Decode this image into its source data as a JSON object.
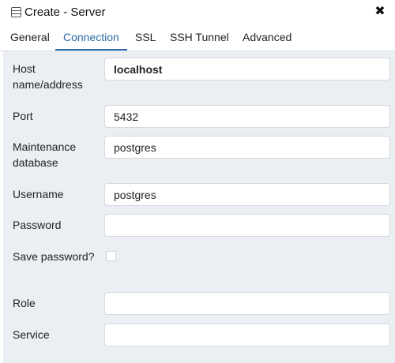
{
  "window": {
    "title": "Create - Server",
    "title_icon": "server-icon",
    "close_icon": "close-icon",
    "close_glyph": "✖"
  },
  "tabs": [
    {
      "label": "General"
    },
    {
      "label": "Connection",
      "active": true
    },
    {
      "label": "SSL"
    },
    {
      "label": "SSH Tunnel"
    },
    {
      "label": "Advanced"
    }
  ],
  "form": {
    "host": {
      "label": "Host name/address",
      "value": "localhost"
    },
    "port": {
      "label": "Port",
      "value": "5432"
    },
    "maintenance_db": {
      "label": "Maintenance database",
      "value": "postgres"
    },
    "username": {
      "label": "Username",
      "value": "postgres"
    },
    "password": {
      "label": "Password",
      "value": ""
    },
    "save_password": {
      "label": "Save password?",
      "checked": false
    },
    "role": {
      "label": "Role",
      "value": ""
    },
    "service": {
      "label": "Service",
      "value": ""
    }
  },
  "colors": {
    "accent": "#2c6aa6",
    "form_background": "#ebeef3"
  }
}
